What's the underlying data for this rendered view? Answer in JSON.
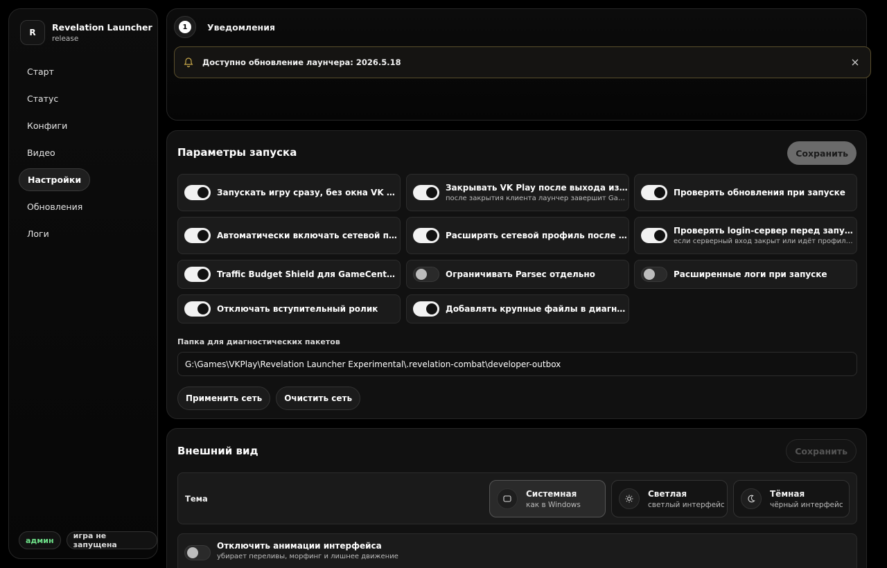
{
  "app": {
    "logo_letter": "R",
    "title": "Revelation Launcher",
    "channel": "release"
  },
  "nav": [
    {
      "label": "Старт"
    },
    {
      "label": "Статус"
    },
    {
      "label": "Конфиги"
    },
    {
      "label": "Видео"
    },
    {
      "label": "Настройки",
      "active": true
    },
    {
      "label": "Обновления"
    },
    {
      "label": "Логи"
    }
  ],
  "status": {
    "role": "админ",
    "game_state": "игра не запущена"
  },
  "notifications": {
    "count": "1",
    "title": "Уведомления",
    "items": [
      {
        "message": "Доступно обновление лаунчера: 2026.5.18"
      }
    ]
  },
  "launch": {
    "title": "Параметры запуска",
    "save_label": "Сохранить",
    "toggles": [
      {
        "label": "Запускать игру сразу, без окна VK Play",
        "sub": "",
        "on": true
      },
      {
        "label": "Закрывать VK Play после выхода из игры",
        "sub": "после закрытия клиента лаунчер завершит GameCenter",
        "on": true
      },
      {
        "label": "Проверять обновления при запуске",
        "sub": "",
        "on": true
      },
      {
        "label": "Автоматически включать сетевой профиль",
        "sub": "",
        "on": true
      },
      {
        "label": "Расширять сетевой профиль после входа",
        "sub": "",
        "on": true
      },
      {
        "label": "Проверять login-сервер перед запуском",
        "sub": "если серверный вход закрыт или идёт профилактика",
        "on": true
      },
      {
        "label": "Traffic Budget Shield для GameCenter и игры",
        "sub": "",
        "on": true
      },
      {
        "label": "Ограничивать Parsec отдельно",
        "sub": "",
        "on": false
      },
      {
        "label": "Расширенные логи при запуске",
        "sub": "",
        "on": false
      },
      {
        "label": "Отключать вступительный ролик",
        "sub": "",
        "on": true
      },
      {
        "label": "Добавлять крупные файлы в диагностику",
        "sub": "",
        "on": true
      }
    ],
    "folder_label": "Папка для диагностических пакетов",
    "folder_value": "G:\\Games\\VKPlay\\Revelation Launcher Experimental\\.revelation-combat\\developer-outbox",
    "apply_net": "Применить сеть",
    "clear_net": "Очистить сеть"
  },
  "appearance": {
    "title": "Внешний вид",
    "save_label": "Сохранить",
    "theme_label": "Тема",
    "themes": [
      {
        "name": "Системная",
        "desc": "как в Windows",
        "icon": "monitor-icon",
        "selected": true
      },
      {
        "name": "Светлая",
        "desc": "светлый интерфейс",
        "icon": "sun-icon",
        "selected": false
      },
      {
        "name": "Тёмная",
        "desc": "чёрный интерфейс",
        "icon": "moon-icon",
        "selected": false
      }
    ],
    "anim_label": "Отключить анимации интерфейса",
    "anim_sub": "убирает переливы, морфинг и лишнее движение",
    "anim_on": false
  },
  "colors": {
    "accent_warn": "#5a4e2c",
    "status_green": "#6fe38a"
  }
}
